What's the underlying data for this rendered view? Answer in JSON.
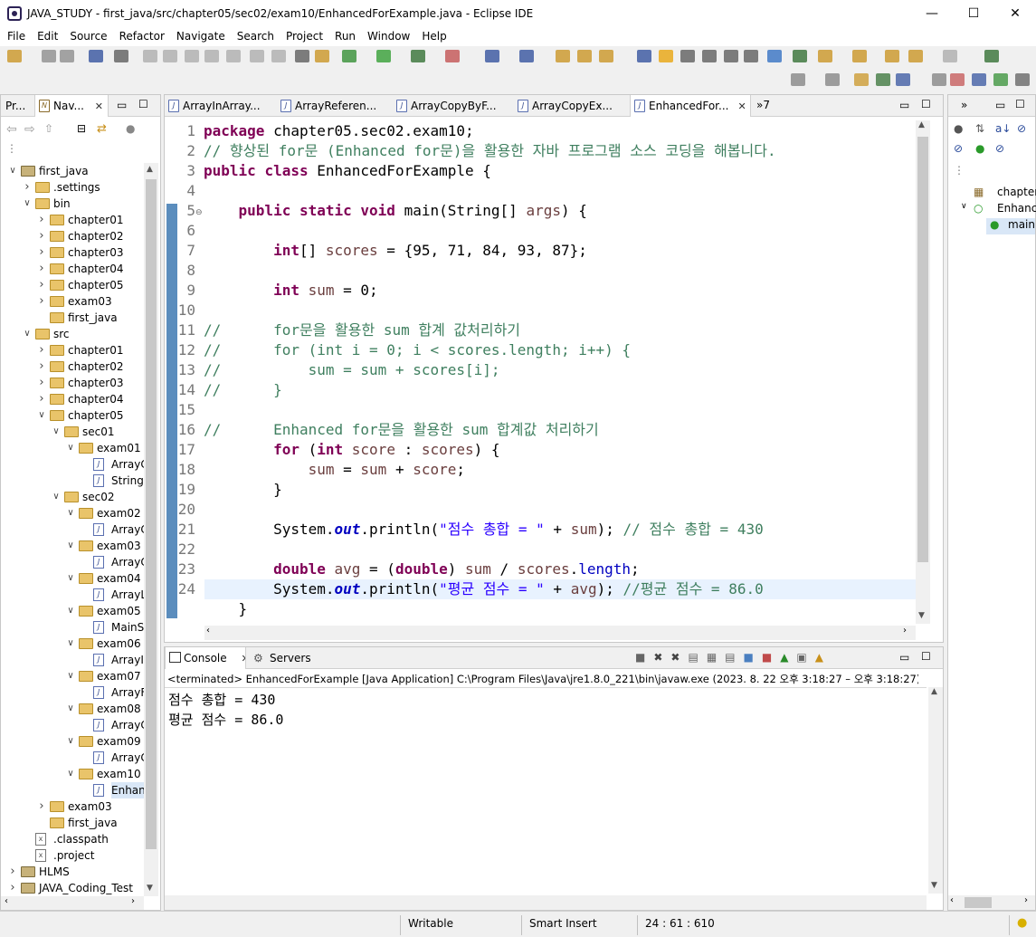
{
  "window": {
    "title": "JAVA_STUDY - first_java/src/chapter05/sec02/exam10/EnhancedForExample.java - Eclipse IDE"
  },
  "menu": [
    "File",
    "Edit",
    "Source",
    "Refactor",
    "Navigate",
    "Search",
    "Project",
    "Run",
    "Window",
    "Help"
  ],
  "left_tabs": {
    "project": "Pr...",
    "navigator": "Nav..."
  },
  "tree": [
    {
      "label": "first_java",
      "depth": 0,
      "type": "project",
      "twisty": "open"
    },
    {
      "label": ".settings",
      "depth": 1,
      "type": "folder",
      "twisty": "closed"
    },
    {
      "label": "bin",
      "depth": 1,
      "type": "folder",
      "twisty": "open"
    },
    {
      "label": "chapter01",
      "depth": 2,
      "type": "folder",
      "twisty": "closed"
    },
    {
      "label": "chapter02",
      "depth": 2,
      "type": "folder",
      "twisty": "closed"
    },
    {
      "label": "chapter03",
      "depth": 2,
      "type": "folder",
      "twisty": "closed"
    },
    {
      "label": "chapter04",
      "depth": 2,
      "type": "folder",
      "twisty": "closed"
    },
    {
      "label": "chapter05",
      "depth": 2,
      "type": "folder",
      "twisty": "closed"
    },
    {
      "label": "exam03",
      "depth": 2,
      "type": "folder",
      "twisty": "closed"
    },
    {
      "label": "first_java",
      "depth": 2,
      "type": "folder",
      "twisty": "none"
    },
    {
      "label": "src",
      "depth": 1,
      "type": "folder",
      "twisty": "open"
    },
    {
      "label": "chapter01",
      "depth": 2,
      "type": "folder",
      "twisty": "closed"
    },
    {
      "label": "chapter02",
      "depth": 2,
      "type": "folder",
      "twisty": "closed"
    },
    {
      "label": "chapter03",
      "depth": 2,
      "type": "folder",
      "twisty": "closed"
    },
    {
      "label": "chapter04",
      "depth": 2,
      "type": "folder",
      "twisty": "closed"
    },
    {
      "label": "chapter05",
      "depth": 2,
      "type": "folder",
      "twisty": "open"
    },
    {
      "label": "sec01",
      "depth": 3,
      "type": "folder",
      "twisty": "open"
    },
    {
      "label": "exam01",
      "depth": 4,
      "type": "folder",
      "twisty": "open"
    },
    {
      "label": "ArrayC",
      "depth": 5,
      "type": "java",
      "twisty": "none"
    },
    {
      "label": "String",
      "depth": 5,
      "type": "java",
      "twisty": "none"
    },
    {
      "label": "sec02",
      "depth": 3,
      "type": "folder",
      "twisty": "open"
    },
    {
      "label": "exam02",
      "depth": 4,
      "type": "folder",
      "twisty": "open"
    },
    {
      "label": "ArrayC",
      "depth": 5,
      "type": "java",
      "twisty": "none"
    },
    {
      "label": "exam03",
      "depth": 4,
      "type": "folder",
      "twisty": "open"
    },
    {
      "label": "ArrayC",
      "depth": 5,
      "type": "java",
      "twisty": "none"
    },
    {
      "label": "exam04",
      "depth": 4,
      "type": "folder",
      "twisty": "open"
    },
    {
      "label": "ArrayL",
      "depth": 5,
      "type": "java",
      "twisty": "none"
    },
    {
      "label": "exam05",
      "depth": 4,
      "type": "folder",
      "twisty": "open"
    },
    {
      "label": "MainS",
      "depth": 5,
      "type": "java",
      "twisty": "none"
    },
    {
      "label": "exam06",
      "depth": 4,
      "type": "folder",
      "twisty": "open"
    },
    {
      "label": "ArrayI",
      "depth": 5,
      "type": "java",
      "twisty": "none"
    },
    {
      "label": "exam07",
      "depth": 4,
      "type": "folder",
      "twisty": "open"
    },
    {
      "label": "ArrayF",
      "depth": 5,
      "type": "java",
      "twisty": "none"
    },
    {
      "label": "exam08",
      "depth": 4,
      "type": "folder",
      "twisty": "open"
    },
    {
      "label": "ArrayC",
      "depth": 5,
      "type": "java",
      "twisty": "none"
    },
    {
      "label": "exam09",
      "depth": 4,
      "type": "folder",
      "twisty": "open"
    },
    {
      "label": "ArrayC",
      "depth": 5,
      "type": "java",
      "twisty": "none"
    },
    {
      "label": "exam10",
      "depth": 4,
      "type": "folder",
      "twisty": "open"
    },
    {
      "label": "Enhan",
      "depth": 5,
      "type": "java",
      "twisty": "none",
      "selected": true
    },
    {
      "label": "exam03",
      "depth": 2,
      "type": "folder",
      "twisty": "closed"
    },
    {
      "label": "first_java",
      "depth": 2,
      "type": "folder",
      "twisty": "none"
    },
    {
      "label": ".classpath",
      "depth": 1,
      "type": "xml",
      "twisty": "none"
    },
    {
      "label": ".project",
      "depth": 1,
      "type": "xml",
      "twisty": "none"
    },
    {
      "label": "HLMS",
      "depth": 0,
      "type": "project",
      "twisty": "closed"
    },
    {
      "label": "JAVA_Coding_Test",
      "depth": 0,
      "type": "project",
      "twisty": "closed"
    }
  ],
  "editor_tabs": [
    "ArrayInArray...",
    "ArrayReferen...",
    "ArrayCopyByF...",
    "ArrayCopyEx...",
    "EnhancedFor..."
  ],
  "editor_overflow": "»7",
  "code_lines": [
    {
      "n": "1",
      "html": "<span class='kw'>package</span> chapter05.sec02.exam10;"
    },
    {
      "n": "2",
      "html": "<span class='cm'>// 향상된 for문 (Enhanced for문)을 활용한 자바 프로그램 소스 코딩을 해봅니다.</span>"
    },
    {
      "n": "3",
      "html": "<span class='kw'>public</span> <span class='kw'>class</span> EnhancedForExample {"
    },
    {
      "n": "4",
      "html": ""
    },
    {
      "n": "5",
      "html": "    <span class='kw'>public</span> <span class='kw'>static</span> <span class='kw'>void</span> main(String[] <span class='var'>args</span>) {",
      "fold": true
    },
    {
      "n": "6",
      "html": ""
    },
    {
      "n": "7",
      "html": "        <span class='kw'>int</span>[] <span class='var'>scores</span> = {95, 71, 84, 93, 87};"
    },
    {
      "n": "8",
      "html": ""
    },
    {
      "n": "9",
      "html": "        <span class='kw'>int</span> <span class='var'>sum</span> = 0;"
    },
    {
      "n": "10",
      "html": ""
    },
    {
      "n": "11",
      "html": "<span class='cm'>//      for문을 활용한 sum 합계 값처리하기</span>"
    },
    {
      "n": "12",
      "html": "<span class='cm'>//      for (int i = 0; i &lt; scores.length; i++) {</span>"
    },
    {
      "n": "13",
      "html": "<span class='cm'>//          sum = sum + scores[i];</span>"
    },
    {
      "n": "14",
      "html": "<span class='cm'>//      }</span>"
    },
    {
      "n": "15",
      "html": ""
    },
    {
      "n": "16",
      "html": "<span class='cm'>//      Enhanced for문을 활용한 sum 합계값 처리하기</span>"
    },
    {
      "n": "17",
      "html": "        <span class='kw'>for</span> (<span class='kw'>int</span> <span class='var'>score</span> : <span class='var'>scores</span>) {"
    },
    {
      "n": "18",
      "html": "            <span class='var'>sum</span> = <span class='var'>sum</span> + <span class='var'>score</span>;"
    },
    {
      "n": "19",
      "html": "        }"
    },
    {
      "n": "20",
      "html": ""
    },
    {
      "n": "21",
      "html": "        System.<span class='fld'>out</span>.println(<span class='str'>\"점수 총합 = \"</span> + <span class='var'>sum</span>); <span class='cm'>// 점수 총합 = 430</span>"
    },
    {
      "n": "22",
      "html": ""
    },
    {
      "n": "23",
      "html": "        <span class='kw'>double</span> <span class='var'>avg</span> = (<span class='kw'>double</span>) <span class='var'>sum</span> / <span class='var'>scores</span>.<span class='fld2'>length</span>;"
    },
    {
      "n": "24",
      "html": "        System.<span class='fld'>out</span>.println(<span class='str'>\"평균 점수 = \"</span> + <span class='var'>avg</span>); <span class='cm'>//평균 점수 = 86.0</span>",
      "current": true
    },
    {
      "n": "",
      "html": "    }"
    }
  ],
  "console": {
    "tab_label": "Console",
    "servers_label": "Servers",
    "header": "<terminated> EnhancedForExample [Java Application] C:\\Program Files\\Java\\jre1.8.0_221\\bin\\javaw.exe  (2023. 8. 22 오후 3:18:27 – 오후 3:18:27)",
    "lines": [
      "점수 총합 = 430",
      "평균 점수 = 86.0"
    ]
  },
  "outline": {
    "items": [
      "chapter",
      "Enhanc",
      "main"
    ]
  },
  "status": {
    "writable": "Writable",
    "insert_mode": "Smart Insert",
    "position": "24 : 61 : 610"
  },
  "colors": {
    "keyword": "#7f0055",
    "comment": "#3f7f5f",
    "string": "#2a00ff",
    "current_line": "#e8f2fe"
  }
}
